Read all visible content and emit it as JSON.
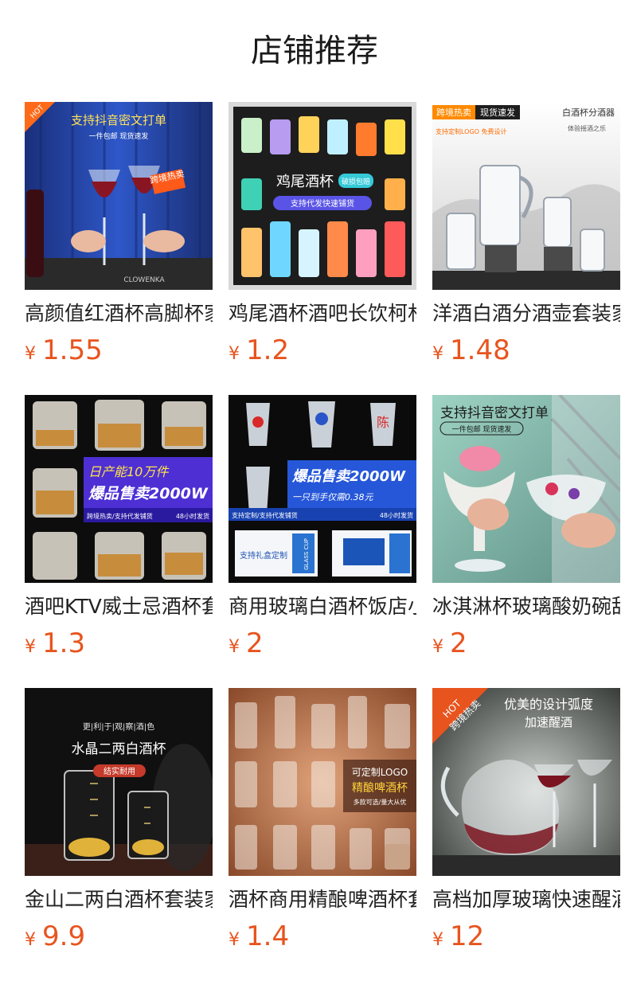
{
  "page": {
    "title": "店铺推荐"
  },
  "products": [
    {
      "name": "高颜值红酒杯高脚杯家用",
      "currency": "¥",
      "price": "1.55",
      "overlay": [
        "支持抖音密文打单",
        "一件包邮 现货速发",
        "跨境热卖",
        "HOT",
        "CLOWENKA"
      ]
    },
    {
      "name": "鸡尾酒杯酒吧长饮柯林杯",
      "currency": "¥",
      "price": "1.2",
      "overlay": [
        "鸡尾酒杯",
        "破损包赔",
        "支持代发快速铺货"
      ]
    },
    {
      "name": "洋酒白酒分酒壶套装家用",
      "currency": "¥",
      "price": "1.48",
      "overlay": [
        "跨境热卖",
        "现货速发",
        "白酒杯分酒器",
        "支持定制LOGO 免费设计",
        "体验摇酒之乐"
      ]
    },
    {
      "name": "酒吧KTV威士忌酒杯套装",
      "currency": "¥",
      "price": "1.3",
      "overlay": [
        "日产能10万件",
        "爆品售卖2000W",
        "跨境热卖/支持代发铺货",
        "48小时发货"
      ]
    },
    {
      "name": "商用玻璃白酒杯饭店小酒杯",
      "currency": "¥",
      "price": "2",
      "overlay": [
        "爆品售卖2000W",
        "一只到手仅需0.38元",
        "支持定制/支持代发铺货",
        "48小时发货",
        "支持礼盒定制",
        "GLASS CUP"
      ]
    },
    {
      "name": "冰淇淋杯玻璃酸奶碗甜品杯",
      "currency": "¥",
      "price": "2",
      "overlay": [
        "支持抖音密文打单",
        "一件包邮 现货速发"
      ]
    },
    {
      "name": "金山二两白酒杯套装家用",
      "currency": "¥",
      "price": "9.9",
      "overlay": [
        "更|利|于|观|察|酒|色",
        "水晶二两白酒杯",
        "结实耐用"
      ]
    },
    {
      "name": "酒杯商用精酿啤酒杯套装",
      "currency": "¥",
      "price": "1.4",
      "overlay": [
        "可定制LOGO",
        "精酿啤酒杯",
        "多款可选/量大从优"
      ]
    },
    {
      "name": "高档加厚玻璃快速醒酒器",
      "currency": "¥",
      "price": "12",
      "overlay": [
        "优美的设计弧度",
        "加速醒酒",
        "跨境热卖",
        "HOT"
      ]
    }
  ],
  "colors": {
    "price": "#e8541e",
    "title": "#1a1a1a",
    "text": "#222222"
  }
}
